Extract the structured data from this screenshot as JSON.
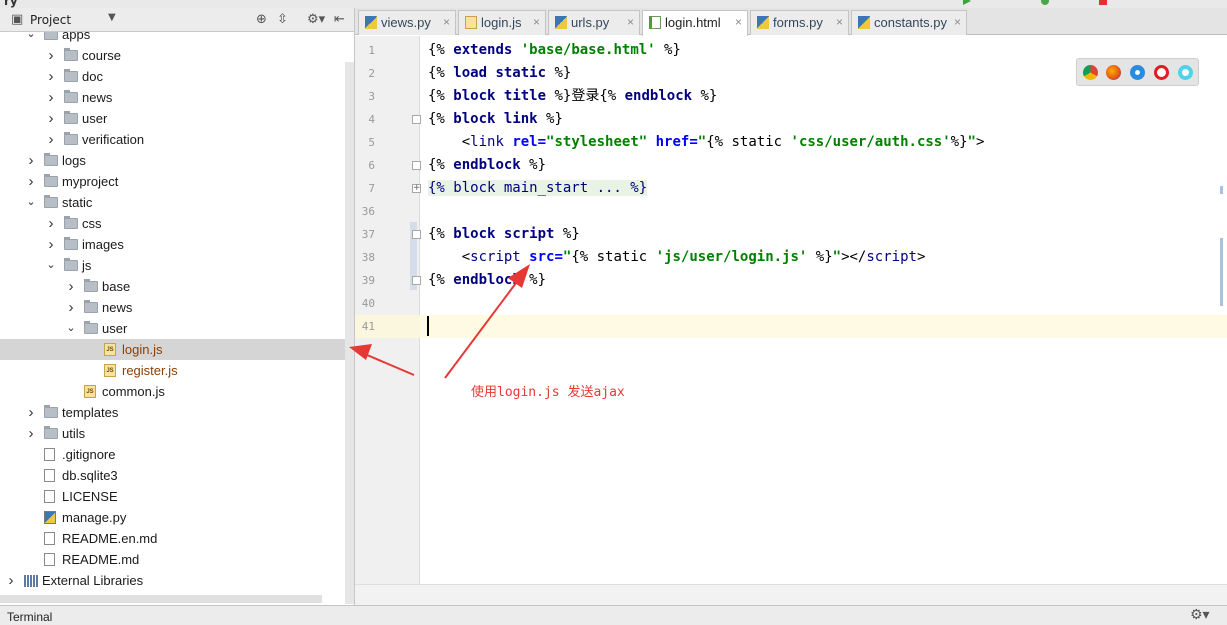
{
  "project_panel": {
    "title": "Project"
  },
  "tree": [
    {
      "label": "apps",
      "type": "folder",
      "depth": 1,
      "expanded": true
    },
    {
      "label": "course",
      "type": "folder",
      "depth": 2,
      "expanded": false
    },
    {
      "label": "doc",
      "type": "folder",
      "depth": 2,
      "expanded": false
    },
    {
      "label": "news",
      "type": "folder",
      "depth": 2,
      "expanded": false
    },
    {
      "label": "user",
      "type": "folder",
      "depth": 2,
      "expanded": false
    },
    {
      "label": "verification",
      "type": "folder",
      "depth": 2,
      "expanded": false
    },
    {
      "label": "logs",
      "type": "folder",
      "depth": 1,
      "expanded": false
    },
    {
      "label": "myproject",
      "type": "folder",
      "depth": 1,
      "expanded": false
    },
    {
      "label": "static",
      "type": "folder",
      "depth": 1,
      "expanded": true
    },
    {
      "label": "css",
      "type": "folder",
      "depth": 2,
      "expanded": false
    },
    {
      "label": "images",
      "type": "folder",
      "depth": 2,
      "expanded": false
    },
    {
      "label": "js",
      "type": "folder",
      "depth": 2,
      "expanded": true
    },
    {
      "label": "base",
      "type": "folder",
      "depth": 3,
      "expanded": false
    },
    {
      "label": "news",
      "type": "folder",
      "depth": 3,
      "expanded": false
    },
    {
      "label": "user",
      "type": "folder",
      "depth": 3,
      "expanded": true
    },
    {
      "label": "login.js",
      "type": "js",
      "depth": 4,
      "selected": true,
      "modified": true
    },
    {
      "label": "register.js",
      "type": "js",
      "depth": 4,
      "modified": true
    },
    {
      "label": "common.js",
      "type": "js",
      "depth": 3
    },
    {
      "label": "templates",
      "type": "folder",
      "depth": 1,
      "expanded": false
    },
    {
      "label": "utils",
      "type": "folder",
      "depth": 1,
      "expanded": false
    },
    {
      "label": ".gitignore",
      "type": "file",
      "depth": 1
    },
    {
      "label": "db.sqlite3",
      "type": "file",
      "depth": 1
    },
    {
      "label": "LICENSE",
      "type": "file",
      "depth": 1
    },
    {
      "label": "manage.py",
      "type": "py",
      "depth": 1
    },
    {
      "label": "README.en.md",
      "type": "file",
      "depth": 1
    },
    {
      "label": "README.md",
      "type": "file",
      "depth": 1
    },
    {
      "label": "External Libraries",
      "type": "lib",
      "depth": 0,
      "expanded": false
    }
  ],
  "tabs": [
    {
      "label": "views.py",
      "icon": "py",
      "active": false
    },
    {
      "label": "login.js",
      "icon": "js",
      "active": false
    },
    {
      "label": "urls.py",
      "icon": "py",
      "active": false
    },
    {
      "label": "login.html",
      "icon": "html",
      "active": true
    },
    {
      "label": "forms.py",
      "icon": "py",
      "active": false
    },
    {
      "label": "constants.py",
      "icon": "py",
      "active": false
    }
  ],
  "editor": {
    "line_numbers": [
      "1",
      "2",
      "3",
      "4",
      "5",
      "6",
      "7",
      "36",
      "37",
      "38",
      "39",
      "40",
      "41"
    ],
    "lines": [
      [
        [
          "d",
          "{% "
        ],
        [
          "kw",
          "extends"
        ],
        [
          "d",
          " "
        ],
        [
          "str",
          "'base/base.html'"
        ],
        [
          "d",
          " %}"
        ]
      ],
      [
        [
          "d",
          "{% "
        ],
        [
          "kw",
          "load"
        ],
        [
          "d",
          " "
        ],
        [
          "kw",
          "static"
        ],
        [
          "d",
          " %}"
        ]
      ],
      [
        [
          "d",
          "{% "
        ],
        [
          "kw",
          "block"
        ],
        [
          "d",
          " "
        ],
        [
          "kw",
          "title"
        ],
        [
          "d",
          " %}登录{% "
        ],
        [
          "kw",
          "endblock"
        ],
        [
          "d",
          " %}"
        ]
      ],
      [
        [
          "d",
          "{% "
        ],
        [
          "kw",
          "block"
        ],
        [
          "d",
          " "
        ],
        [
          "kw",
          "link"
        ],
        [
          "d",
          " %}"
        ]
      ],
      [
        [
          "d",
          "    <"
        ],
        [
          "tag",
          "link"
        ],
        [
          "d",
          " "
        ],
        [
          "attr",
          "rel="
        ],
        [
          "str",
          "\"stylesheet\""
        ],
        [
          "d",
          " "
        ],
        [
          "attr",
          "href="
        ],
        [
          "str",
          "\""
        ],
        [
          "d",
          "{% static "
        ],
        [
          "str",
          "'css/user/auth.css'"
        ],
        [
          "d",
          "%}"
        ],
        [
          "str",
          "\""
        ],
        [
          "d",
          ">"
        ]
      ],
      [
        [
          "d",
          "{% "
        ],
        [
          "kw",
          "endblock"
        ],
        [
          "d",
          " %}"
        ]
      ],
      [
        [
          "fold",
          "{% block main_start ... %}"
        ]
      ],
      [],
      [
        [
          "d",
          "{% "
        ],
        [
          "kw",
          "block"
        ],
        [
          "d",
          " "
        ],
        [
          "kw",
          "script"
        ],
        [
          "d",
          " %}"
        ]
      ],
      [
        [
          "d",
          "    <"
        ],
        [
          "tag",
          "script"
        ],
        [
          "d",
          " "
        ],
        [
          "attr",
          "src="
        ],
        [
          "str",
          "\""
        ],
        [
          "d",
          "{% static "
        ],
        [
          "str",
          "'js/user/login.js'"
        ],
        [
          "d",
          " %}"
        ],
        [
          "str",
          "\""
        ],
        [
          "d",
          "></"
        ],
        [
          "tag",
          "script"
        ],
        [
          "d",
          ">"
        ]
      ],
      [
        [
          "d",
          "{% "
        ],
        [
          "kw",
          "endblock"
        ],
        [
          "d",
          " %}"
        ]
      ],
      [],
      []
    ]
  },
  "annotation": {
    "text": "使用login.js 发送ajax",
    "color": "#e53935"
  },
  "browsers": [
    "chrome-icon",
    "firefox-icon",
    "safari-icon",
    "opera-icon",
    "ie-icon"
  ],
  "status": {
    "terminal_label": "Terminal"
  }
}
